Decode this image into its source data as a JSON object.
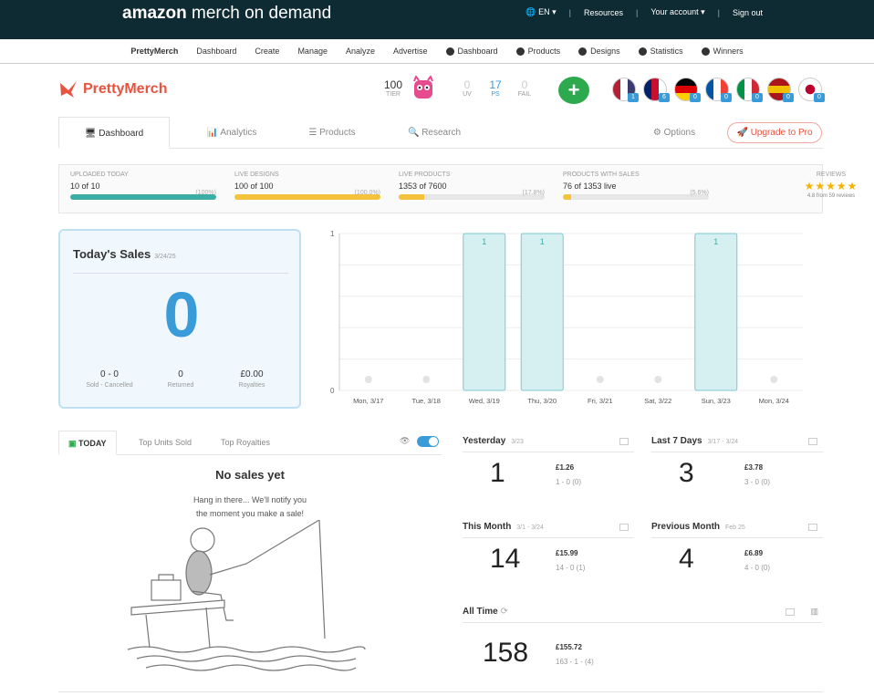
{
  "topbar": {
    "brand_a": "amazon",
    "brand_b": " merch on demand",
    "lang": "EN",
    "resources": "Resources",
    "account": "Your account",
    "signout": "Sign out"
  },
  "subnav": [
    {
      "label": "PrettyMerch",
      "active": true,
      "icon": false
    },
    {
      "label": "Dashboard",
      "icon": false
    },
    {
      "label": "Create",
      "icon": false
    },
    {
      "label": "Manage",
      "icon": false
    },
    {
      "label": "Analyze",
      "icon": false
    },
    {
      "label": "Advertise",
      "icon": false
    },
    {
      "label": "Dashboard",
      "icon": true
    },
    {
      "label": "Products",
      "icon": true
    },
    {
      "label": "Designs",
      "icon": true
    },
    {
      "label": "Statistics",
      "icon": true
    },
    {
      "label": "Winners",
      "icon": true
    }
  ],
  "logo": "PrettyMerch",
  "tier": {
    "value": "100",
    "label": "TIER"
  },
  "mini_stats": [
    {
      "value": "0",
      "label": "UV"
    },
    {
      "value": "17",
      "label": "PS"
    },
    {
      "value": "0",
      "label": "FAIL"
    }
  ],
  "add_label": "+",
  "flags": [
    {
      "name": "us-flag-icon",
      "badge": "1"
    },
    {
      "name": "uk-flag-icon",
      "badge": "6"
    },
    {
      "name": "de-flag-icon",
      "badge": "0"
    },
    {
      "name": "fr-flag-icon",
      "badge": "0"
    },
    {
      "name": "it-flag-icon",
      "badge": "0"
    },
    {
      "name": "es-flag-icon",
      "badge": "0"
    },
    {
      "name": "jp-flag-icon",
      "badge": "0"
    }
  ],
  "tabs": {
    "dashboard": "Dashboard",
    "analytics": "Analytics",
    "products": "Products",
    "research": "Research",
    "options": "Options",
    "upgrade": "Upgrade to Pro"
  },
  "progress": [
    {
      "header": "UPLOADED TODAY",
      "value": "10 of 10",
      "pct": "(100%)",
      "fraction": 1.0,
      "color": "#3aaea5"
    },
    {
      "header": "LIVE DESIGNS",
      "value": "100 of 100",
      "pct": "(100.0%)",
      "fraction": 1.0,
      "color": "#f5c33b"
    },
    {
      "header": "LIVE PRODUCTS",
      "value": "1353 of 7600",
      "pct": "(17.8%)",
      "fraction": 0.178,
      "color": "#f5c33b"
    },
    {
      "header": "PRODUCTS WITH SALES",
      "value": "76 of 1353 live",
      "pct": "(5.6%)",
      "fraction": 0.056,
      "color": "#f5c33b"
    }
  ],
  "reviews": {
    "header": "REVIEWS",
    "stars": "★★★★★",
    "sub": "4.8 from 59 reviews"
  },
  "today": {
    "title": "Today's Sales",
    "date": "3/24/25",
    "big": "0",
    "sold": {
      "value": "0 - 0",
      "label": "Sold - Cancelled"
    },
    "returned": {
      "value": "0",
      "label": "Returned"
    },
    "royalties": {
      "value": "£0.00",
      "label": "Royalties"
    }
  },
  "chart_data": {
    "type": "bar",
    "categories": [
      "Mon, 3/17",
      "Tue, 3/18",
      "Wed, 3/19",
      "Thu, 3/20",
      "Fri, 3/21",
      "Sat, 3/22",
      "Sun, 3/23",
      "Mon, 3/24"
    ],
    "values": [
      0,
      0,
      1,
      1,
      0,
      0,
      1,
      0
    ],
    "ylim": [
      0,
      1
    ],
    "yticks": [
      "0",
      "1"
    ],
    "grid": true,
    "bar_color": "#d6eff1",
    "bar_stroke": "#7ccad0"
  },
  "bottom_tabs": {
    "today": "TODAY",
    "units": "Top Units Sold",
    "royalties": "Top Royalties"
  },
  "nosales": {
    "title": "No sales yet",
    "line1": "Hang in there... We'll notify you",
    "line2": "the moment you make a sale!"
  },
  "cards": {
    "yesterday": {
      "title": "Yesterday",
      "date": "3/23",
      "big": "1",
      "amt": "£1.26",
      "cnt": "1 - 0 (0)"
    },
    "last7": {
      "title": "Last 7 Days",
      "date": "3/17 - 3/24",
      "big": "3",
      "amt": "£3.78",
      "cnt": "3 - 0 (0)"
    },
    "month": {
      "title": "This Month",
      "date": "3/1 - 3/24",
      "big": "14",
      "amt": "£15.99",
      "cnt": "14 - 0 (1)"
    },
    "prevmonth": {
      "title": "Previous Month",
      "date": "Feb 25",
      "big": "4",
      "amt": "£6.89",
      "cnt": "4 - 0 (0)"
    },
    "alltime": {
      "title": "All Time",
      "big": "158",
      "amt": "£155.72",
      "cnt": "163 - 1 - (4)"
    }
  }
}
